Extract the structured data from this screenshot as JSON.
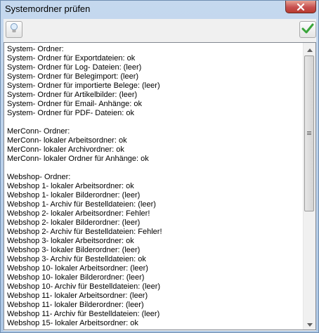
{
  "window": {
    "title": "Systemordner prüfen"
  },
  "toolbar": {
    "left_icon": "lightbulb-icon",
    "right_icon": "checkmark-icon"
  },
  "content": {
    "lines": [
      "System- Ordner:",
      "System- Ordner für Exportdateien: ok",
      "System- Ordner für Log- Dateien: (leer)",
      "System- Ordner für Belegimport: (leer)",
      "System- Ordner für importierte Belege: (leer)",
      "System- Ordner für Artikelbilder: (leer)",
      "System- Ordner für Email- Anhänge: ok",
      "System- Ordner für PDF- Dateien: ok",
      "",
      "MerConn- Ordner:",
      "MerConn- lokaler Arbeitsordner: ok",
      "MerConn- lokaler Archivordner: ok",
      "MerConn- lokaler Ordner für Anhänge: ok",
      "",
      "Webshop- Ordner:",
      "Webshop 1- lokaler Arbeitsordner: ok",
      "Webshop 1- lokaler Bilderordner: (leer)",
      "Webshop 1- Archiv für Bestelldateien: (leer)",
      "Webshop 2- lokaler Arbeitsordner: Fehler!",
      "Webshop 2- lokaler Bilderordner: (leer)",
      "Webshop 2- Archiv für Bestelldateien: Fehler!",
      "Webshop 3- lokaler Arbeitsordner: ok",
      "Webshop 3- lokaler Bilderordner: (leer)",
      "Webshop 3- Archiv für Bestelldateien: ok",
      "Webshop 10- lokaler Arbeitsordner: (leer)",
      "Webshop 10- lokaler Bilderordner: (leer)",
      "Webshop 10- Archiv für Bestelldateien: (leer)",
      "Webshop 11- lokaler Arbeitsordner: (leer)",
      "Webshop 11- lokaler Bilderordner: (leer)",
      "Webshop 11- Archiv für Bestelldateien: (leer)",
      "Webshop 15- lokaler Arbeitsordner: ok"
    ]
  },
  "colors": {
    "titlebar": "#b9d1ea",
    "close_button": "#c75050",
    "client_bg": "#f0f0f0",
    "check_green": "#3aa53a"
  }
}
